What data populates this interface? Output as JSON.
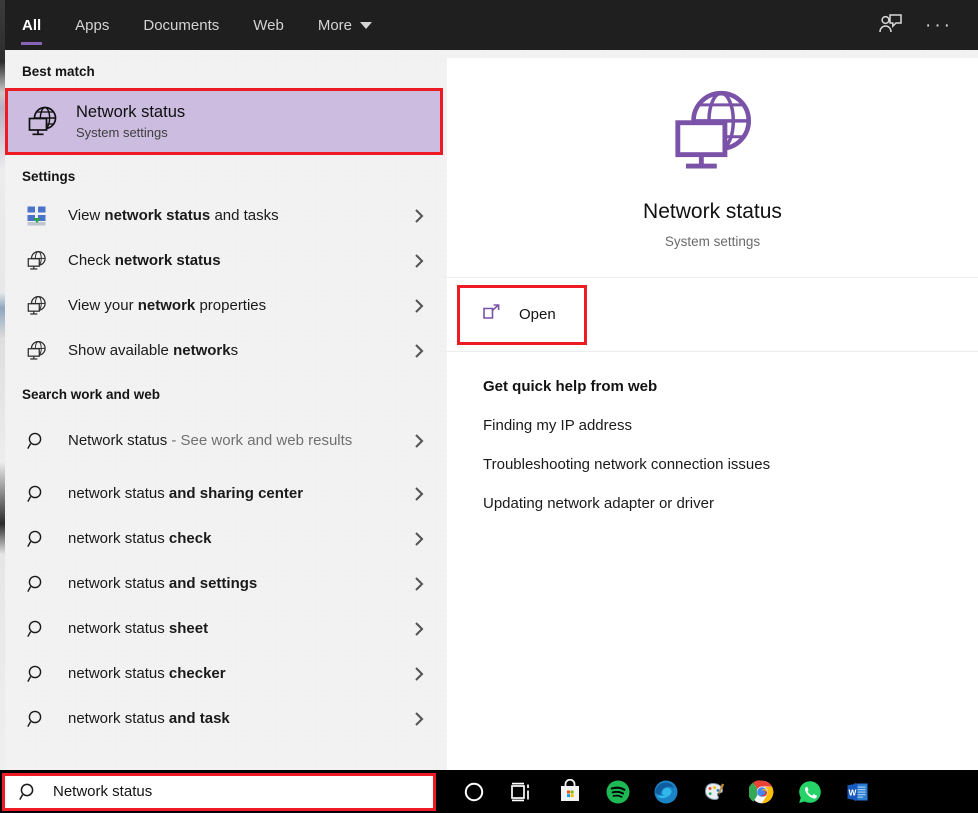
{
  "header": {
    "tabs": [
      {
        "label": "All",
        "active": true
      },
      {
        "label": "Apps",
        "active": false
      },
      {
        "label": "Documents",
        "active": false
      },
      {
        "label": "Web",
        "active": false
      },
      {
        "label": "More",
        "active": false,
        "has_caret": true
      }
    ],
    "feedback_icon": "feedback-person-icon",
    "more_options_icon": "ellipsis-icon",
    "more_options_label": "···",
    "accent_color": "#8764B8",
    "background_color": "#1F1F1F"
  },
  "left_panel": {
    "best_match_heading": "Best match",
    "best_match": {
      "title": "Network status",
      "subtitle": "System settings",
      "icon": "network-globe-monitor-icon",
      "highlight_color": "#CBBCE0",
      "annotation_color": "#ED1C24"
    },
    "settings_heading": "Settings",
    "settings_items": [
      {
        "pre": "View ",
        "bold": "network status",
        "post": " and tasks",
        "icon": "network-sharing-center-icon"
      },
      {
        "pre": "Check ",
        "bold": "network status",
        "post": "",
        "icon": "network-globe-monitor-icon"
      },
      {
        "pre": "View your ",
        "bold": "network",
        "post": " properties",
        "icon": "network-globe-monitor-icon"
      },
      {
        "pre": "Show available ",
        "bold": "network",
        "post": "s",
        "icon": "network-globe-monitor-icon"
      }
    ],
    "web_heading": "Search work and web",
    "web_items": [
      {
        "pre": "Network status",
        "bold": "",
        "post": " - See work and web results",
        "icon": "search-icon",
        "post_muted": true
      },
      {
        "pre": "network status ",
        "bold": "and sharing center",
        "post": "",
        "icon": "search-icon"
      },
      {
        "pre": "network status ",
        "bold": "check",
        "post": "",
        "icon": "search-icon"
      },
      {
        "pre": "network status ",
        "bold": "and settings",
        "post": "",
        "icon": "search-icon"
      },
      {
        "pre": "network status ",
        "bold": "sheet",
        "post": "",
        "icon": "search-icon"
      },
      {
        "pre": "network status ",
        "bold": "checker",
        "post": "",
        "icon": "search-icon"
      },
      {
        "pre": "network status ",
        "bold": "and task",
        "post": "",
        "icon": "search-icon"
      }
    ],
    "chevron_icon": "chevron-right-icon"
  },
  "preview": {
    "app_icon": "network-globe-monitor-icon",
    "icon_color": "#7A52A8",
    "title": "Network status",
    "subtitle": "System settings",
    "open_label": "Open",
    "open_icon": "external-link-icon",
    "quick_help_title": "Get quick help from web",
    "quick_help_links": [
      "Finding my IP address",
      "Troubleshooting network connection issues",
      "Updating network adapter or driver"
    ]
  },
  "taskbar": {
    "search_value": "Network status",
    "search_icon": "search-icon",
    "items": [
      {
        "name": "cortana-icon",
        "label": "Cortana"
      },
      {
        "name": "task-view-icon",
        "label": "Task View"
      },
      {
        "name": "microsoft-store-icon",
        "label": "Microsoft Store"
      },
      {
        "name": "spotify-icon",
        "label": "Spotify"
      },
      {
        "name": "microsoft-edge-icon",
        "label": "Microsoft Edge"
      },
      {
        "name": "paint-icon",
        "label": "Paint"
      },
      {
        "name": "google-chrome-icon",
        "label": "Google Chrome"
      },
      {
        "name": "whatsapp-icon",
        "label": "WhatsApp"
      },
      {
        "name": "microsoft-word-icon",
        "label": "Microsoft Word"
      }
    ]
  }
}
